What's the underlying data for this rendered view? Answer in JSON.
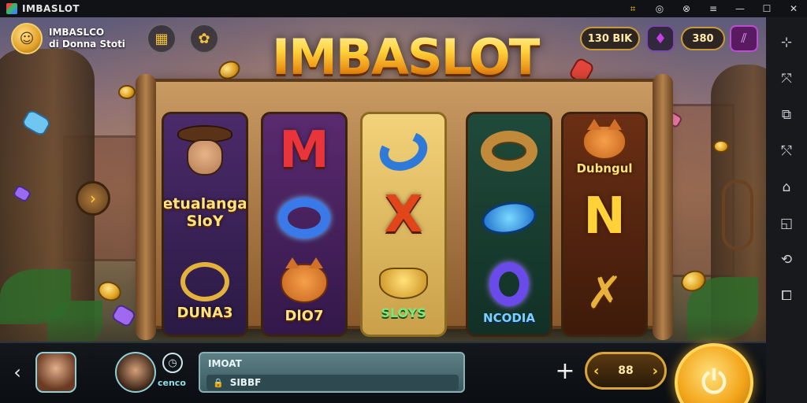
{
  "window": {
    "title": "IMBASLOT",
    "controls": [
      "⌗",
      "◎",
      "⊗",
      "≡",
      "✕",
      "☐",
      "✕"
    ]
  },
  "profile": {
    "line1": "IMBASLCO",
    "line2": "di Donna Stoti"
  },
  "top_icons": {
    "calendar": "▦",
    "settings": "✿"
  },
  "logo": "IMBASLOT",
  "currency": {
    "coins": "130 BIK",
    "gems_icon": "♦",
    "score": "380",
    "menu_icon": "⫽"
  },
  "reels": [
    {
      "top_caption": "Petualangan SloY",
      "bottom_caption": "DUNA3"
    },
    {
      "top_letter": "M",
      "bottom_caption": "DlO7"
    },
    {
      "top_letter": "X",
      "bottom_caption": "SLOYS"
    },
    {
      "bottom_caption": "NCODIA"
    },
    {
      "top_caption": "Dubngul",
      "middle_letter": "N"
    }
  ],
  "bottom": {
    "back_icon": "‹",
    "clock_icon": "◷",
    "under_label": "cenco",
    "info_title": "IMOAT",
    "info_field": "SIBBF",
    "lock_icon": "🔒",
    "plus_icon": "+",
    "bet_value": "88",
    "bet_left": "‹",
    "bet_right": "›",
    "spin_icon": "⏻"
  },
  "sidebar": {
    "icons": [
      "⊹",
      "⤧",
      "⧉",
      "⤲",
      "⌂",
      "◱",
      "⟲",
      "⧠"
    ]
  },
  "colors": {
    "accent_gold": "#ffd23a",
    "bar_teal": "#5c7f86",
    "menu_purple": "#5a1a62"
  }
}
